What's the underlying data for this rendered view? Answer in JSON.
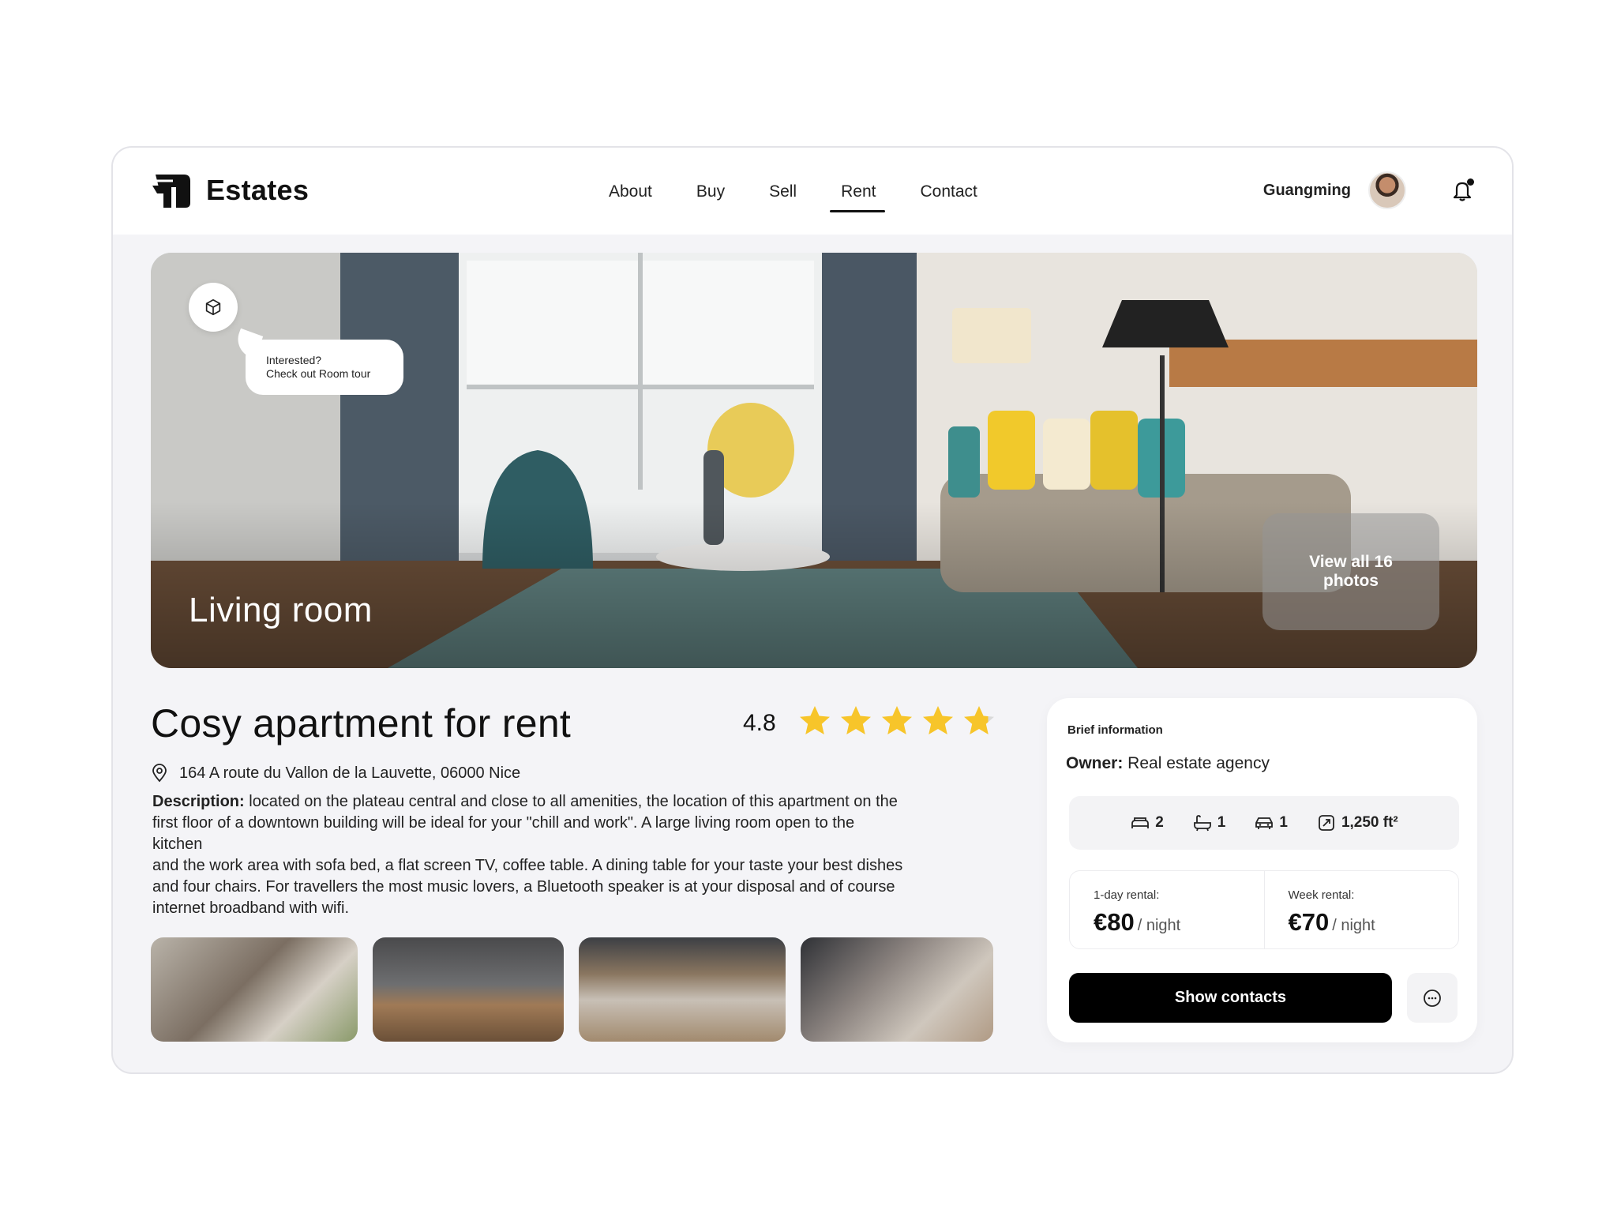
{
  "header": {
    "brand": "Estates",
    "nav": [
      {
        "label": "About",
        "active": false
      },
      {
        "label": "Buy",
        "active": false
      },
      {
        "label": "Sell",
        "active": false
      },
      {
        "label": "Rent",
        "active": true
      },
      {
        "label": "Contact",
        "active": false
      }
    ],
    "user_name": "Guangming",
    "notification_indicator": true
  },
  "hero": {
    "tour_line1": "Interested?",
    "tour_line2": "Check out Room tour",
    "caption": "Living room",
    "view_all_line1": "View all 16",
    "view_all_line2": "photos"
  },
  "listing": {
    "title": "Cosy apartment for rent",
    "rating": "4.8",
    "rating_value": 4.8,
    "stars_max": 5,
    "address": "164 A route du Vallon de la Lauvette, 06000 Nice",
    "description_label": "Description:",
    "description_lines": [
      " located on the plateau central and close to all amenities, the location of this apartment on the",
      "first floor of a downtown building will be ideal for your \"chill and work\".  A large living room open to the",
      "kitchen",
      "and the work area with sofa bed, a flat screen TV, coffee table. A dining table for your taste your best dishes",
      "and four chairs. For travellers the most music lovers, a Bluetooth speaker is at your disposal and of course",
      "internet broadband with wifi."
    ]
  },
  "info_card": {
    "title": "Brief information",
    "owner_label": "Owner:",
    "owner_value": " Real estate agency",
    "features": [
      {
        "icon": "bed-icon",
        "value": "2"
      },
      {
        "icon": "bathtub-icon",
        "value": "1"
      },
      {
        "icon": "car-icon",
        "value": "1"
      },
      {
        "icon": "area-icon",
        "value": "1,250 ft²"
      }
    ],
    "day_label": "1-day rental:",
    "day_price": "€80",
    "week_label": "Week rental:",
    "week_price": "€70",
    "unit": "/ night",
    "contacts_button": "Show contacts"
  },
  "colors": {
    "accent": "#000000",
    "star": "#f7c52a",
    "star_empty": "#d9d9d9",
    "background": "#f4f4f7"
  }
}
